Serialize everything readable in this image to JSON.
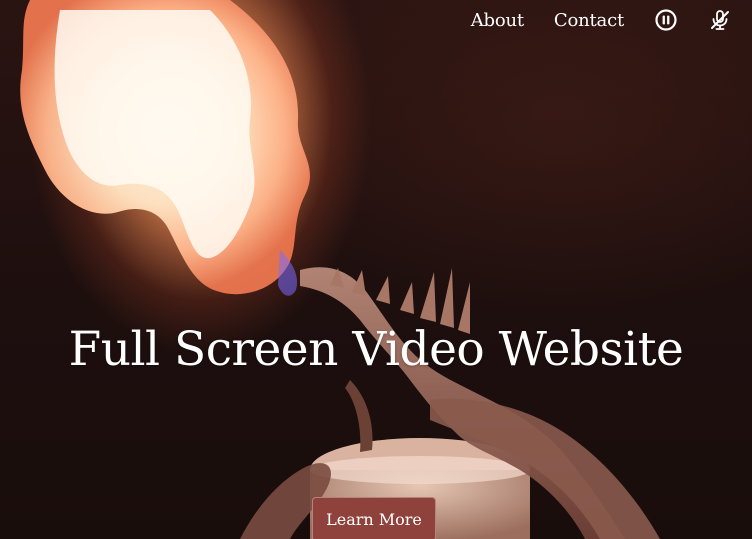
{
  "nav": {
    "about_label": "About",
    "contact_label": "Contact",
    "pause_icon": "pause-circle-icon",
    "mute_icon": "microphone-muted-icon"
  },
  "hero": {
    "title": "Full Screen Video Website",
    "cta_label": "Learn More"
  },
  "colors": {
    "text": "#ffffff",
    "cta_background": "#8e423b",
    "page_background": "#1b0e0c"
  }
}
